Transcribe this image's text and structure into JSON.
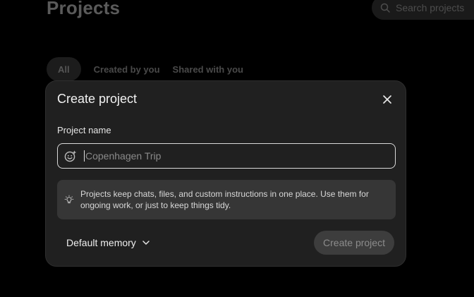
{
  "background": {
    "title": "Projects",
    "search_placeholder": "Search projects",
    "tabs": [
      {
        "label": "All",
        "active": true
      },
      {
        "label": "Created by you",
        "active": false
      },
      {
        "label": "Shared with you",
        "active": false
      }
    ]
  },
  "modal": {
    "title": "Create project",
    "close_icon": "close-icon",
    "name_field": {
      "label": "Project name",
      "placeholder": "Copenhagen Trip",
      "value": "",
      "icon": "emoji-sparkle-icon"
    },
    "info": {
      "icon": "lightbulb-icon",
      "text": "Projects keep chats, files, and custom instructions in one place. Use them for ongoing work, or just to keep things tidy."
    },
    "memory_dropdown": {
      "selected": "Default memory",
      "icon": "chevron-down-icon"
    },
    "create_button": {
      "label": "Create project",
      "disabled": true
    }
  },
  "colors": {
    "background": "#000000",
    "modal": "#202020",
    "info_box": "#363636",
    "button_disabled": "#3d3d3d"
  }
}
